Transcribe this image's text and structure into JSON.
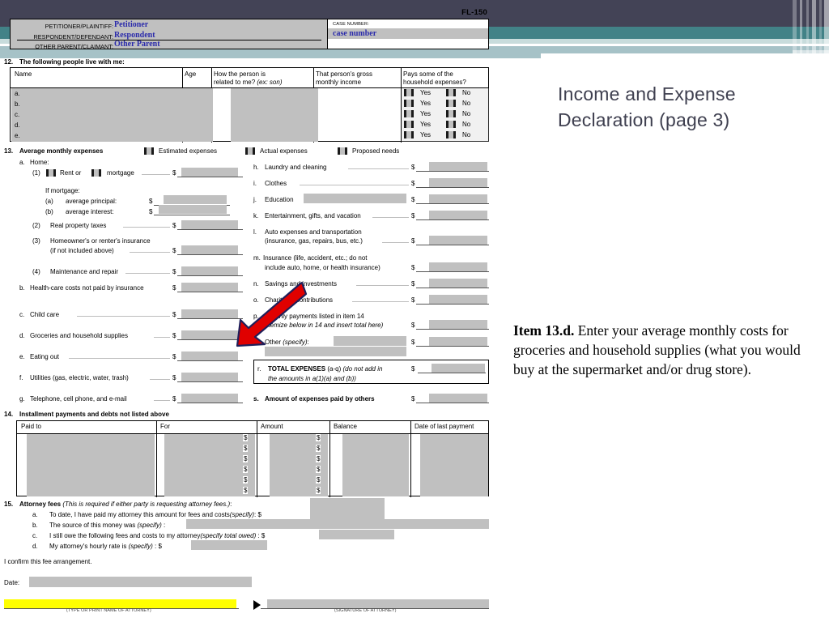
{
  "slide": {
    "title": "Income and Expense Declaration (page 3)",
    "callout_label": "Item 13.d.",
    "callout_text": "  Enter your average monthly costs for groceries and household supplies (what you would buy at the supermarket and/or drug store)."
  },
  "form": {
    "form_number": "FL-150",
    "caption": {
      "rows": [
        {
          "label": "PETITIONER/PLAINTIFF:",
          "value": "Petitioner"
        },
        {
          "label": "RESPONDENT/DEFENDANT:",
          "value": "Respondent"
        },
        {
          "label": "OTHER PARENT/CLAIMANT:",
          "value": "Other Parent"
        }
      ],
      "case_number_label": "CASE NUMBER:",
      "case_number_value": "case number"
    },
    "item12": {
      "number": "12.",
      "heading": "The following people live with me:",
      "columns": [
        "Name",
        "Age",
        {
          "l1": "How the person is",
          "l2": "related to me?",
          "l2i": "(ex: son)"
        },
        {
          "l1": "That person's gross",
          "l2": "monthly income"
        },
        {
          "l1": "Pays some of the",
          "l2": "household expenses?"
        }
      ],
      "row_letters": [
        "a.",
        "b.",
        "c.",
        "d.",
        "e."
      ],
      "yes_label": "Yes",
      "no_label": "No"
    },
    "item13": {
      "number": "13.",
      "heading": "Average monthly expenses",
      "options": [
        "Estimated expenses",
        "Actual expenses",
        "Proposed needs"
      ],
      "left": [
        {
          "key": "a.",
          "text": "Home:"
        },
        {
          "key": "(1)",
          "text": "Rent or",
          "text2": "mortgage",
          "dollar": true
        },
        {
          "key": "",
          "text": "If mortgage:"
        },
        {
          "key": "(a)",
          "text": "average principal:",
          "dollar": true
        },
        {
          "key": "(b)",
          "text": "average interest:",
          "dollar": true
        },
        {
          "key": "(2)",
          "text": "Real property taxes",
          "dollar": true
        },
        {
          "key": "(3)",
          "text": "Homeowner's or renter's insurance",
          "text2": "(if not included above)",
          "dollar": true
        },
        {
          "key": "(4)",
          "text": "Maintenance and repair",
          "dollar": true
        },
        {
          "key": "b.",
          "text": "Health-care costs not paid by insurance",
          "dollar": true
        },
        {
          "key": "c.",
          "text": "Child care",
          "dollar": true
        },
        {
          "key": "d.",
          "text": "Groceries and household supplies",
          "dollar": true
        },
        {
          "key": "e.",
          "text": "Eating out",
          "dollar": true
        },
        {
          "key": "f.",
          "text": "Utilities (gas, electric, water, trash)",
          "dollar": true
        },
        {
          "key": "g.",
          "text": "Telephone, cell phone, and e-mail",
          "dollar": true
        }
      ],
      "right": [
        {
          "key": "h.",
          "text": "Laundry and cleaning"
        },
        {
          "key": "i.",
          "text": "Clothes"
        },
        {
          "key": "j.",
          "text": "Education"
        },
        {
          "key": "k.",
          "text": "Entertainment, gifts, and vacation"
        },
        {
          "key": "l.",
          "text": "Auto expenses and transportation",
          "text2": "(insurance, gas, repairs, bus, etc.)"
        },
        {
          "key": "m.",
          "text": "Insurance (life, accident, etc.; do not",
          "text2": "include auto, home, or health insurance)"
        },
        {
          "key": "n.",
          "text": "Savings and investments"
        },
        {
          "key": "o.",
          "text": "Charitable contributions"
        },
        {
          "key": "p.",
          "text": "Monthly payments listed in item 14",
          "text2": "(itemize below in 14 and insert total here)"
        },
        {
          "key": "q.",
          "text": "Other",
          "texti": "(specify)",
          "text2": ":"
        }
      ],
      "total": {
        "key": "r.",
        "bold": "TOTAL EXPENSES",
        "plain": "(a-q)",
        "ital": "(do not add in",
        "ital2": "the amounts in a(1)(a) and (b))"
      },
      "paid_by_others": {
        "key": "s.",
        "text": "Amount of expenses paid by others"
      }
    },
    "item14": {
      "number": "14.",
      "heading": "Installment payments and debts not listed above",
      "columns": [
        "Paid to",
        "For",
        "Amount",
        "Balance",
        "Date of last payment"
      ],
      "dollar_sign": "$",
      "row_count": 6
    },
    "item15": {
      "number": "15.",
      "heading": "Attorney fees",
      "heading_ital": "(This is required if either party is requesting attorney fees.)",
      "heading_colon": ":",
      "rows": [
        {
          "key": "a.",
          "text": "To date, I have paid my attorney this amount for fees and costs",
          "ital": "(specify)",
          "tail": ": $"
        },
        {
          "key": "b.",
          "text": "The source of this money was ",
          "ital": "(specify)",
          "tail": " :"
        },
        {
          "key": "c.",
          "text": "I still owe the following fees and costs to my attorney",
          "ital": "(specify total owed)",
          "tail": " : $"
        },
        {
          "key": "d.",
          "text": "My attorney's hourly rate is ",
          "ital": "(specify)",
          "tail": " : $"
        }
      ],
      "confirm": "I confirm this fee arrangement.",
      "date_label": "Date:",
      "sig_left": "(TYPE OR PRINT NAME OF ATTORNEY)",
      "sig_right": "(SIGNATURE OF ATTORNEY)"
    }
  },
  "colors": {
    "band_dark": "#434356",
    "band_teal": "#428287",
    "band_pale": "#a6c2c7",
    "form_gray": "#c0c0c0",
    "caption_blue": "#2b2bab",
    "arrow_red": "#e00000",
    "arrow_outline": "#1f1f5a",
    "highlight_yellow": "#ffff00",
    "title_text": "#3f4050"
  }
}
